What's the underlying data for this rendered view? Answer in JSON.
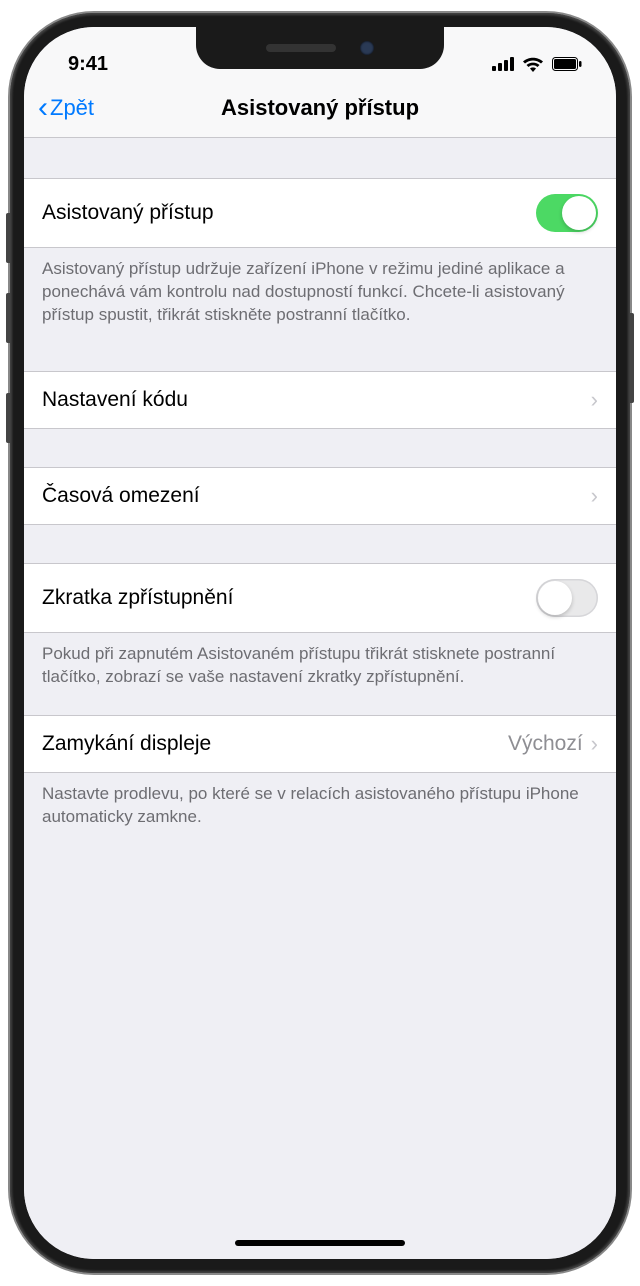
{
  "status": {
    "time": "9:41"
  },
  "nav": {
    "back": "Zpět",
    "title": "Asistovaný přístup"
  },
  "rows": {
    "guided_access": {
      "label": "Asistovaný přístup",
      "on": true
    },
    "passcode": {
      "label": "Nastavení kódu"
    },
    "time_limits": {
      "label": "Časová omezení"
    },
    "shortcut": {
      "label": "Zkratka zpřístupnění",
      "on": false
    },
    "display_lock": {
      "label": "Zamykání displeje",
      "value": "Výchozí"
    }
  },
  "footers": {
    "guided_access": "Asistovaný přístup udržuje zařízení iPhone v režimu jediné aplikace a ponechává vám kontrolu nad dostupností funkcí. Chcete-li asistovaný přístup spustit, třikrát stiskněte postranní tlačítko.",
    "shortcut": "Pokud při zapnutém Asistovaném přístupu třikrát stisknete postranní tlačítko, zobrazí se vaše nastavení zkratky zpřístupnění.",
    "display_lock": "Nastavte prodlevu, po které se v relacích asistovaného přístupu iPhone automaticky zamkne."
  }
}
